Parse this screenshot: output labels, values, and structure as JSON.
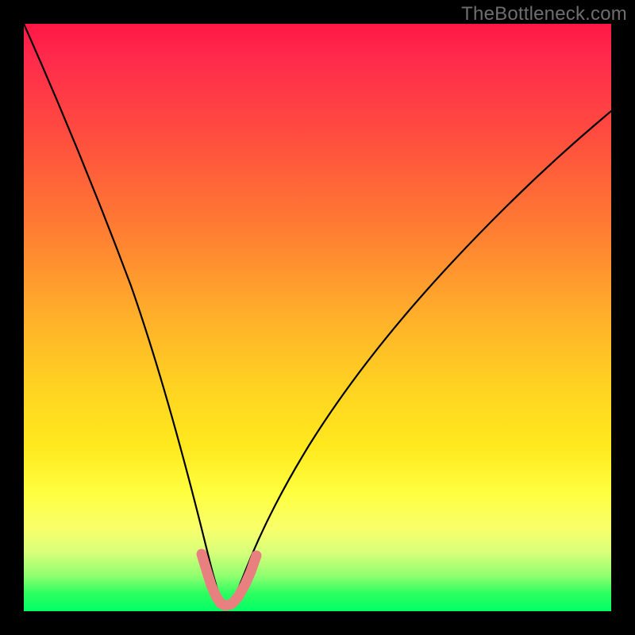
{
  "watermark": "TheBottleneck.com",
  "chart_data": {
    "type": "line",
    "title": "",
    "xlabel": "",
    "ylabel": "",
    "xlim": [
      0,
      100
    ],
    "ylim": [
      0,
      100
    ],
    "background": {
      "description": "vertical gradient mapping high values (top) to red and low values (bottom) to green",
      "stops": [
        {
          "pos": 0,
          "color": "#ff1744"
        },
        {
          "pos": 50,
          "color": "#ffb02a"
        },
        {
          "pos": 80,
          "color": "#ffff40"
        },
        {
          "pos": 100,
          "color": "#00ff66"
        }
      ]
    },
    "series": [
      {
        "name": "curve",
        "color": "#000000",
        "x": [
          0,
          4,
          8,
          12,
          16,
          20,
          24,
          26,
          28,
          30,
          31.5,
          33,
          34.5,
          36,
          38,
          42,
          48,
          56,
          64,
          72,
          80,
          88,
          96,
          100
        ],
        "y": [
          100,
          91,
          80,
          68,
          55,
          42,
          28,
          20,
          12,
          6,
          2,
          0.5,
          0.5,
          2,
          6,
          12,
          20,
          30,
          40,
          49,
          57,
          64,
          70,
          73
        ]
      }
    ],
    "highlight": {
      "name": "bottom-highlight",
      "color": "#e98080",
      "x": [
        29,
        30,
        31,
        32,
        32.5,
        33,
        34,
        35,
        36,
        37,
        38
      ],
      "y": [
        7,
        4,
        2,
        1,
        0.8,
        0.7,
        0.8,
        1.2,
        2.2,
        4,
        6
      ]
    },
    "annotations": [
      {
        "text": "TheBottleneck.com",
        "position": "top-right",
        "color": "#6e6e6e"
      }
    ]
  }
}
